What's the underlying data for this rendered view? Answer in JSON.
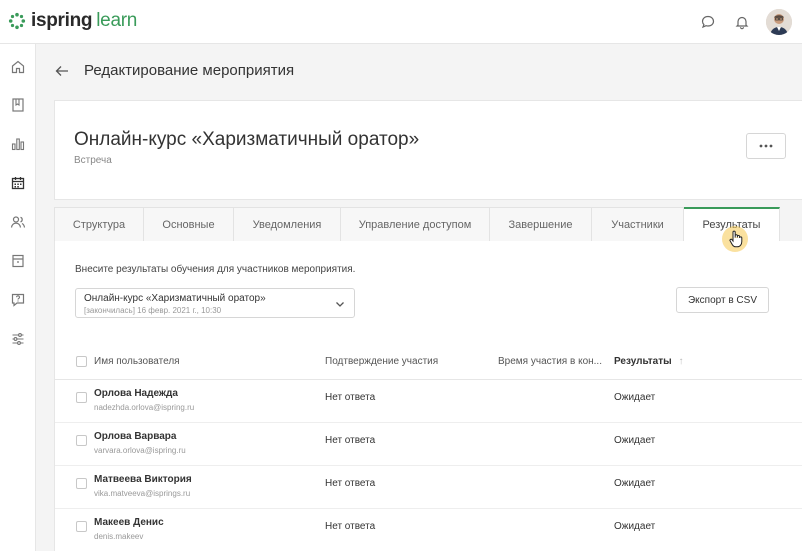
{
  "brand": {
    "name_part1": "ispring",
    "name_part2": "learn",
    "accent_color": "#3a9b5a"
  },
  "topbar": {
    "icons": [
      "chat-bubble-icon",
      "bell-icon"
    ],
    "avatar": "user-avatar"
  },
  "sidebar": {
    "items": [
      {
        "icon": "home-icon"
      },
      {
        "icon": "book-icon"
      },
      {
        "icon": "bar-chart-icon"
      },
      {
        "icon": "calendar-icon",
        "active": true
      },
      {
        "icon": "users-icon"
      },
      {
        "icon": "archive-icon"
      },
      {
        "icon": "question-chat-icon"
      },
      {
        "icon": "sliders-icon"
      }
    ]
  },
  "header": {
    "title": "Редактирование мероприятия"
  },
  "event": {
    "title": "Онлайн-курс «Харизматичный оратор»",
    "type": "Встреча",
    "more_label": "•••"
  },
  "tabs": [
    {
      "label": "Структура"
    },
    {
      "label": "Основные"
    },
    {
      "label": "Уведомления"
    },
    {
      "label": "Управление доступом"
    },
    {
      "label": "Завершение"
    },
    {
      "label": "Участники"
    },
    {
      "label": "Результаты",
      "active": true
    }
  ],
  "results": {
    "instructions": "Внесите результаты обучения для участников мероприятия.",
    "session_select": {
      "title": "Онлайн-курс «Харизматичный оратор»",
      "subtitle": "[закончилась] 16 февр. 2021 г., 10:30"
    },
    "export_label": "Экспорт в CSV",
    "columns": {
      "user": "Имя пользователя",
      "confirmation": "Подтверждение участия",
      "time": "Время участия в кон...",
      "result": "Результаты",
      "sort_indicator": "↑"
    },
    "rows": [
      {
        "name": "Орлова Надежда",
        "email": "nadezhda.orlova@ispring.ru",
        "confirmation": "Нет ответа",
        "result": "Ожидает"
      },
      {
        "name": "Орлова Варвара",
        "email": "varvara.orlova@ispring.ru",
        "confirmation": "Нет ответа",
        "result": "Ожидает"
      },
      {
        "name": "Матвеева Виктория",
        "email": "vika.matveeva@isprings.ru",
        "confirmation": "Нет ответа",
        "result": "Ожидает"
      },
      {
        "name": "Макеев Денис",
        "email": "denis.makeev",
        "confirmation": "Нет ответа",
        "result": "Ожидает"
      }
    ]
  }
}
